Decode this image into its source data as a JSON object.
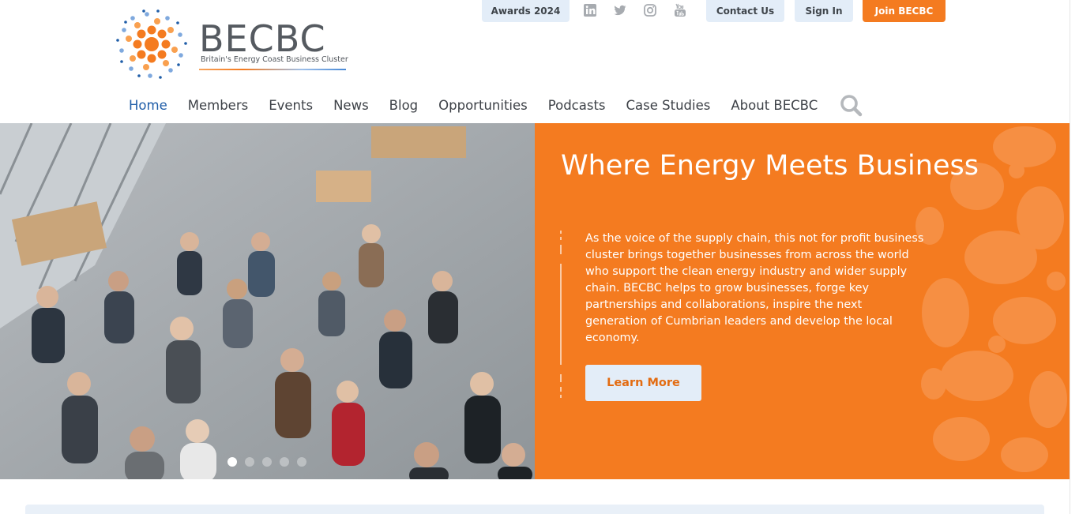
{
  "brand": {
    "name": "BECBC",
    "tagline": "Britain's Energy Coast Business Cluster",
    "colors": {
      "orange": "#f47b20",
      "light_blue": "#e3edf8",
      "nav_active": "#1f5da8"
    }
  },
  "utility_bar": {
    "awards": "Awards 2024",
    "social": [
      "linkedin-icon",
      "twitter-icon",
      "instagram-icon",
      "youtube-icon"
    ],
    "contact": "Contact Us",
    "signin": "Sign In",
    "join": "Join BECBC"
  },
  "nav": {
    "items": [
      {
        "label": "Home",
        "active": true
      },
      {
        "label": "Members"
      },
      {
        "label": "Events"
      },
      {
        "label": "News"
      },
      {
        "label": "Blog"
      },
      {
        "label": "Opportunities"
      },
      {
        "label": "Podcasts"
      },
      {
        "label": "Case Studies"
      },
      {
        "label": "About BECBC"
      }
    ],
    "search_icon": "search-icon"
  },
  "hero": {
    "title": "Where Energy Meets Business",
    "body": "As the voice of the supply chain, this not for profit business cluster brings together businesses from across the world who support the clean energy industry and wider supply chain. BECBC helps to grow businesses, forge key partnerships and collaborations, inspire the next generation of Cumbrian leaders and develop the local economy.",
    "cta": "Learn More",
    "image": "networking-event-photo",
    "slides_total": 5,
    "slide_active": 1
  }
}
